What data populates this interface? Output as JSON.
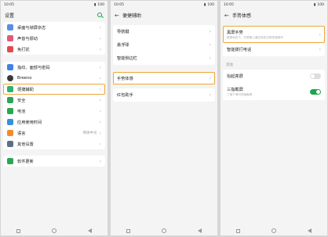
{
  "status": {
    "time": "10:05",
    "battery": "100"
  },
  "screen1": {
    "title": "设置",
    "items": [
      {
        "label": "桌面与锁屏杂志",
        "color": "#5b8de8"
      },
      {
        "label": "声音与振动",
        "color": "#e25a7a"
      },
      {
        "label": "免打扰",
        "color": "#e14b4b"
      },
      {
        "label": "指纹、面部与密码",
        "color": "#3c82e6"
      },
      {
        "label": "Breeno",
        "color": "#3a3a3a"
      },
      {
        "label": "便捷辅助",
        "color": "#2fb26c"
      },
      {
        "label": "安全",
        "color": "#2fa35c"
      },
      {
        "label": "电池",
        "color": "#27a74f"
      },
      {
        "label": "应用使用时间",
        "color": "#3a8ee0"
      },
      {
        "label": "语言",
        "value": "简体中文",
        "color": "#f28d2d"
      },
      {
        "label": "其他设置",
        "color": "#5d6f86"
      },
      {
        "label": "软件更新",
        "color": "#29a55a"
      }
    ]
  },
  "screen2": {
    "title": "便捷辅助",
    "items": [
      {
        "label": "导航键"
      },
      {
        "label": "悬浮球"
      },
      {
        "label": "智能侧边栏"
      },
      {
        "label": "手势体感"
      },
      {
        "label": "红包助手"
      }
    ]
  },
  "screen3": {
    "title": "手势体感",
    "gesture": {
      "label": "黑屏手势",
      "sub": "黑屏状态下，在屏幕上通过特定手势快速操作"
    },
    "call": {
      "label": "智能拨打电话"
    },
    "section": "其他",
    "raise": {
      "label": "抬起亮屏",
      "state": "off"
    },
    "three": {
      "label": "三指截屏",
      "sub": "三指下滑可快速截屏",
      "state": "on"
    }
  },
  "accent": "#1fa34a",
  "highlight": "#f0a636"
}
